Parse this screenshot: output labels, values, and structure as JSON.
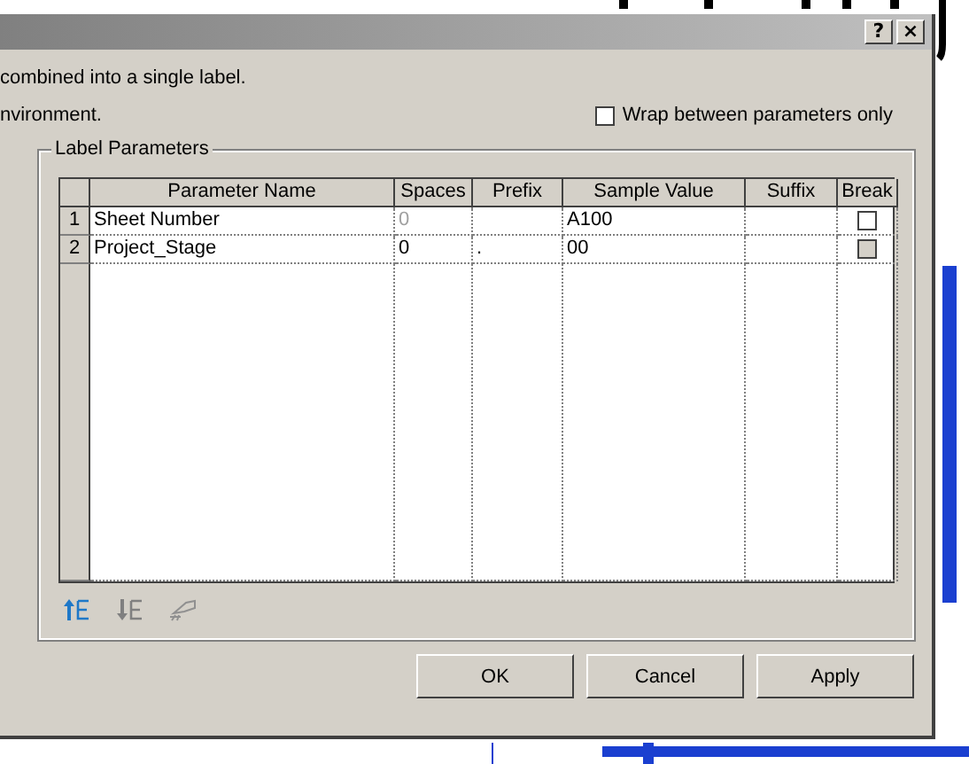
{
  "dialog": {
    "help_button": "?",
    "close_button": "×"
  },
  "description": [
    "combined into a single label.",
    "nvironment."
  ],
  "wrap_option": {
    "label": "Wrap between parameters only",
    "checked": false
  },
  "group": {
    "title": "Label Parameters",
    "columns": [
      "Parameter Name",
      "Spaces",
      "Prefix",
      "Sample Value",
      "Suffix",
      "Break"
    ],
    "rows": [
      {
        "number": "1",
        "name": "Sheet Number",
        "spaces": "0",
        "spaces_disabled": true,
        "prefix": "",
        "sample_value": "A100",
        "suffix": "",
        "break_checked": false,
        "break_disabled": false
      },
      {
        "number": "2",
        "name": "Project_Stage",
        "spaces": "0",
        "spaces_disabled": false,
        "prefix": ".",
        "sample_value": "00",
        "suffix": "",
        "break_checked": false,
        "break_disabled": true
      }
    ]
  },
  "buttons": [
    "OK",
    "Cancel",
    "Apply"
  ]
}
